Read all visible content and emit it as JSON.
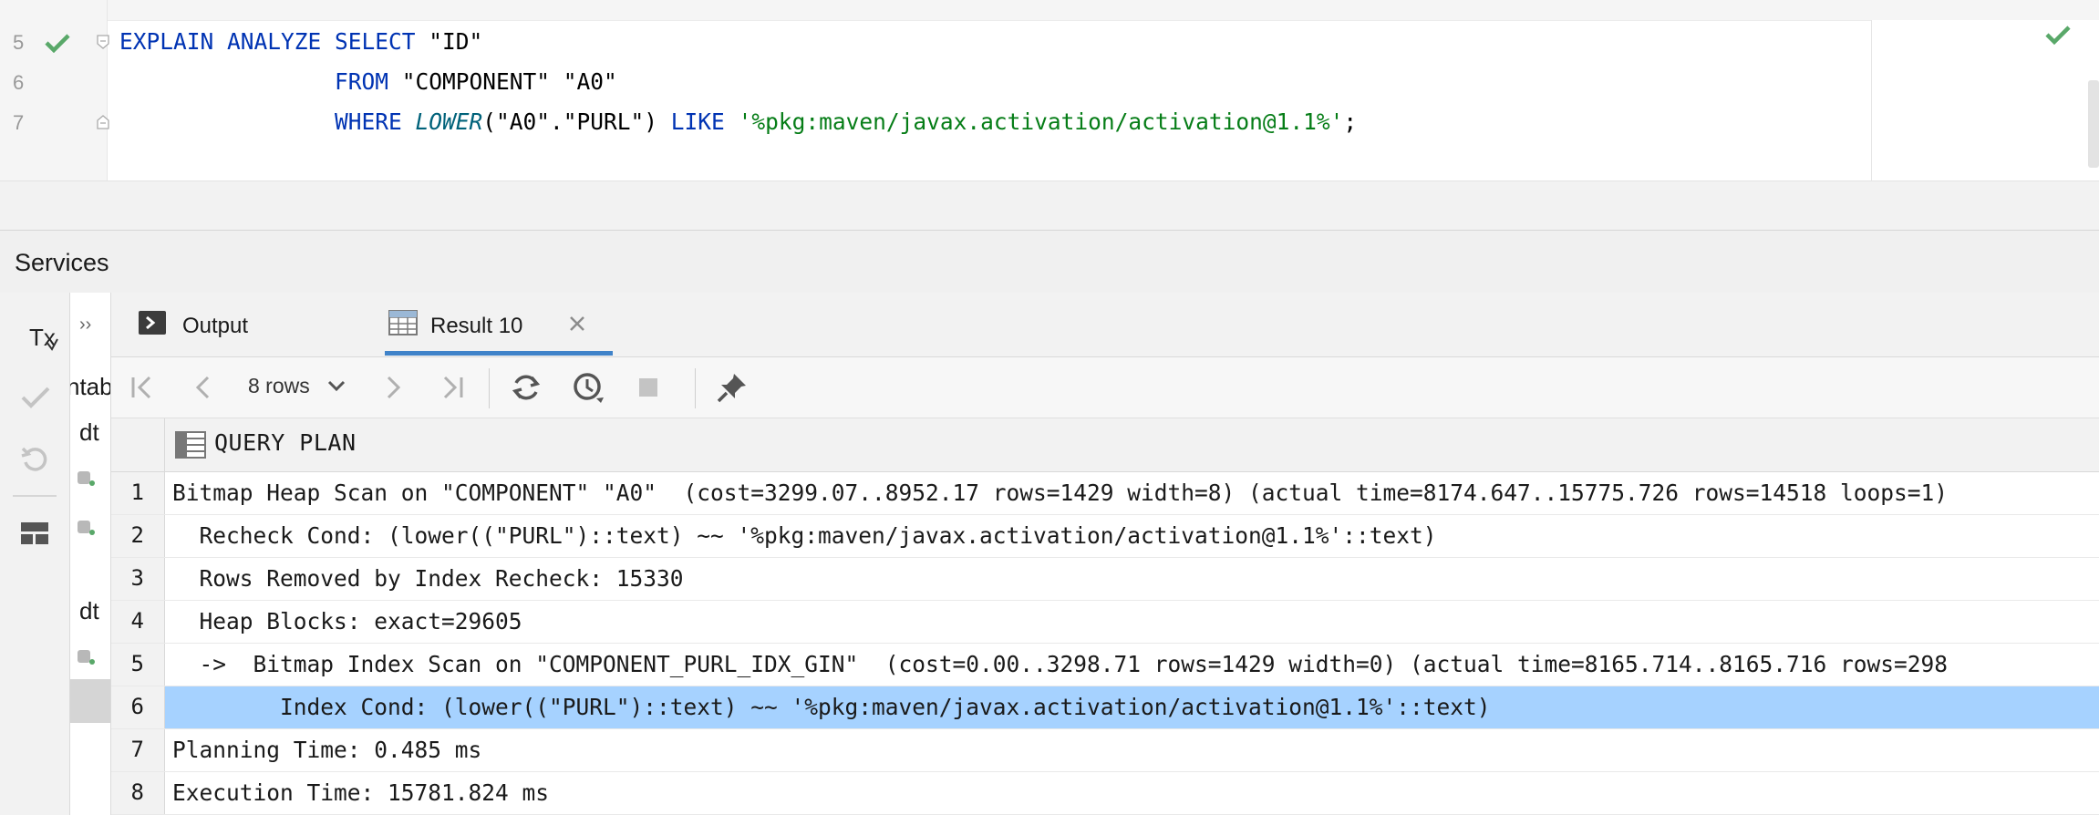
{
  "editor": {
    "lines": [
      {
        "number": "5",
        "status": "check-icon",
        "tokens": [
          {
            "t": "EXPLAIN ANALYZE SELECT ",
            "c": "kw"
          },
          {
            "t": "\"ID\"",
            "c": "id"
          }
        ]
      },
      {
        "number": "6",
        "status": "",
        "tokens": [
          {
            "t": "                FROM ",
            "c": "kw"
          },
          {
            "t": "\"COMPONENT\" \"A0\"",
            "c": "id"
          }
        ]
      },
      {
        "number": "7",
        "status": "",
        "tokens": [
          {
            "t": "                WHERE ",
            "c": "kw"
          },
          {
            "t": "LOWER",
            "c": "fn"
          },
          {
            "t": "(\"A0\".\"PURL\") ",
            "c": "id"
          },
          {
            "t": "LIKE ",
            "c": "kw"
          },
          {
            "t": "'%pkg:maven/javax.activation/activation@1.1%'",
            "c": "str"
          },
          {
            "t": ";",
            "c": "op"
          }
        ]
      }
    ]
  },
  "services": {
    "title": "Services",
    "toolbar": {
      "tx_label": "Tx",
      "icons": [
        "commit-icon",
        "rollback-icon",
        "layout-icon"
      ]
    },
    "tree": {
      "expand_label": "››",
      "items": [
        "ntab",
        "dt",
        "dt"
      ]
    }
  },
  "tabs": [
    {
      "label": "Output",
      "icon": "console-icon",
      "active": false
    },
    {
      "label": "Result 10",
      "icon": "table-icon",
      "active": true,
      "closable": true
    }
  ],
  "result_toolbar": {
    "rows_label": "8 rows"
  },
  "grid": {
    "column": "QUERY PLAN",
    "selected_row": 6,
    "rows": [
      {
        "n": "1",
        "text": "Bitmap Heap Scan on \"COMPONENT\" \"A0\"  (cost=3299.07..8952.17 rows=1429 width=8) (actual time=8174.647..15775.726 rows=14518 loops=1)"
      },
      {
        "n": "2",
        "text": "  Recheck Cond: (lower((\"PURL\")::text) ~~ '%pkg:maven/javax.activation/activation@1.1%'::text)"
      },
      {
        "n": "3",
        "text": "  Rows Removed by Index Recheck: 15330"
      },
      {
        "n": "4",
        "text": "  Heap Blocks: exact=29605"
      },
      {
        "n": "5",
        "text": "  ->  Bitmap Index Scan on \"COMPONENT_PURL_IDX_GIN\"  (cost=0.00..3298.71 rows=1429 width=0) (actual time=8165.714..8165.716 rows=298"
      },
      {
        "n": "6",
        "text": "        Index Cond: (lower((\"PURL\")::text) ~~ '%pkg:maven/javax.activation/activation@1.1%'::text)"
      },
      {
        "n": "7",
        "text": "Planning Time: 0.485 ms"
      },
      {
        "n": "8",
        "text": "Execution Time: 15781.824 ms"
      }
    ]
  },
  "colors": {
    "keyword": "#0033b3",
    "string": "#067d17",
    "selection": "#a6d2ff",
    "tab_underline": "#4083c9",
    "check": "#59a869"
  }
}
